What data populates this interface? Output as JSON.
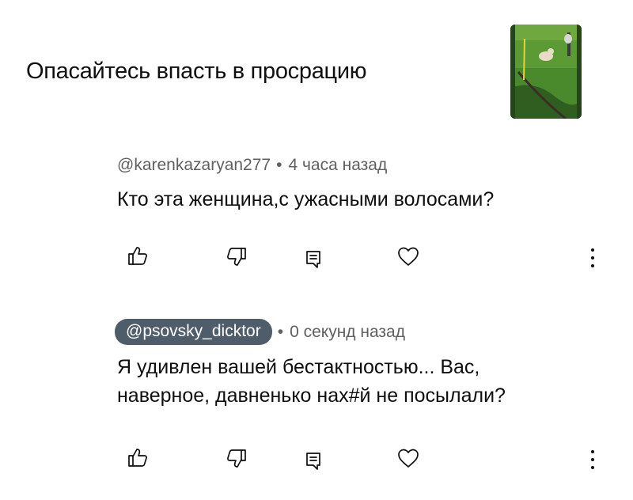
{
  "video": {
    "title": "Опасайтесь впасть в просрацию"
  },
  "comments": [
    {
      "author": "@karenkazaryan277",
      "time": "4 часа назад",
      "text_lines": [
        "Кто эта женщина,с ужасными волосами?"
      ],
      "author_highlighted": false
    },
    {
      "author": "@psovsky_dicktor",
      "time": "0 секунд назад",
      "text_lines": [
        "Я удивлен вашей бестактностью... Вас,",
        "наверное, давненько нах#й не посылали?"
      ],
      "author_highlighted": true
    }
  ],
  "separator": "•",
  "icons": [
    "thumbs-up-icon",
    "thumbs-down-icon",
    "reply-icon",
    "heart-icon",
    "more-vert-icon"
  ]
}
